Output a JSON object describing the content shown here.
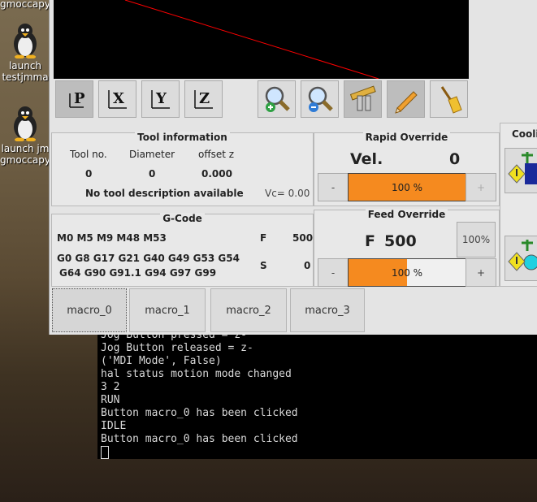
{
  "desktop": {
    "icons": [
      {
        "label_top": "gmoccapy",
        "label_bottom": ""
      },
      {
        "label_top": "launch",
        "label_bottom": "testjmma"
      },
      {
        "label_top": "launch jm",
        "label_bottom": "gmoccapy"
      }
    ]
  },
  "toolbar": {
    "view_p": "P",
    "view_x": "X",
    "view_y": "Y",
    "view_z": "Z"
  },
  "tool_info": {
    "title": "Tool information",
    "headers": [
      "Tool no.",
      "Diameter",
      "offset z"
    ],
    "values": [
      "0",
      "0",
      "0.000"
    ],
    "description": "No tool description available",
    "vc": "Vc= 0.00"
  },
  "gcode": {
    "title": "G-Code",
    "mcodes": "M0 M5 M9 M48 M53",
    "f_label": "F",
    "f_value": "500",
    "gcodes_line1": "G0 G8 G17 G21 G40 G49 G53 G54",
    "gcodes_line2": "G64 G90 G91.1 G94 G97 G99",
    "s_label": "S",
    "s_value": "0"
  },
  "rapid_override": {
    "title": "Rapid Override",
    "vel_label": "Vel.",
    "vel_value": "0",
    "minus": "-",
    "plus": "+",
    "percent_text": "100 %",
    "percent": 100
  },
  "feed_override": {
    "title": "Feed Override",
    "f_label": "F",
    "f_value": "500",
    "reset_label": "100%",
    "minus": "-",
    "plus": "+",
    "percent_text": "100 %",
    "fill_fraction": 0.5
  },
  "cooling": {
    "title": "Coolin"
  },
  "macros": [
    "macro_0",
    "macro_1",
    "macro_2",
    "macro_3"
  ],
  "terminal": {
    "lines": [
      "Jog Button pressed = z-",
      "Jog Button released = z-",
      "('MDI Mode', False)",
      "hal status motion mode changed",
      "3 2",
      "RUN",
      "Button macro_0 has been clicked",
      "IDLE",
      "Button macro_0 has been clicked"
    ]
  },
  "colors": {
    "accent_orange": "#f58a1f",
    "toolpath_red": "#ff0000"
  }
}
